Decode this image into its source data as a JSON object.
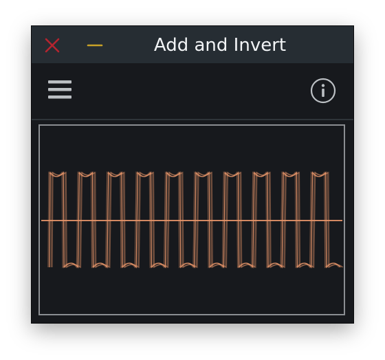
{
  "window": {
    "title": "Add and Invert"
  },
  "colors": {
    "titlebar": "#262d33",
    "background": "#17191d",
    "close": "#b5242f",
    "minimize": "#c9a227",
    "icon": "#bcc0c4",
    "trace": "#e8966a",
    "scope_border": "#8b8e92"
  },
  "icons": {
    "close": "close-icon",
    "minimize": "minimize-icon",
    "menu": "hamburger-menu-icon",
    "info": "info-icon"
  },
  "scope": {
    "cycles": 10,
    "signal": "square-wave"
  }
}
